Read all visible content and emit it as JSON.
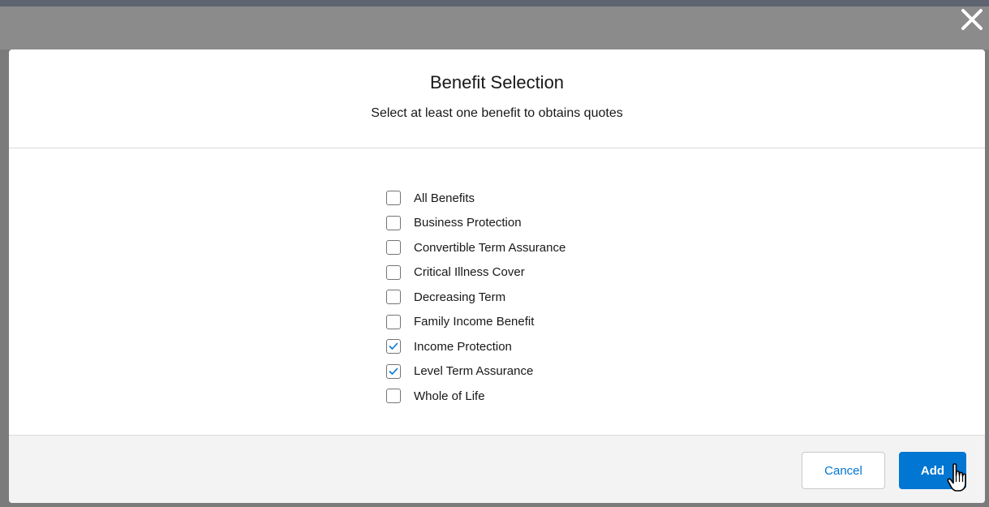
{
  "modal": {
    "title": "Benefit Selection",
    "subtitle": "Select at least one benefit to obtains quotes"
  },
  "benefits": [
    {
      "label": "All Benefits",
      "checked": false
    },
    {
      "label": "Business Protection",
      "checked": false
    },
    {
      "label": "Convertible Term Assurance",
      "checked": false
    },
    {
      "label": "Critical Illness Cover",
      "checked": false
    },
    {
      "label": "Decreasing Term",
      "checked": false
    },
    {
      "label": "Family Income Benefit",
      "checked": false
    },
    {
      "label": "Income Protection",
      "checked": true
    },
    {
      "label": "Level Term Assurance",
      "checked": true
    },
    {
      "label": "Whole of Life",
      "checked": false
    }
  ],
  "footer": {
    "cancel_label": "Cancel",
    "add_label": "Add"
  },
  "icons": {
    "close": "close-icon",
    "check": "checkmark-icon",
    "cursor": "hand-pointer-icon"
  },
  "colors": {
    "brand_blue": "#0176d3",
    "overlay": "#7b7b7b",
    "footer_bg": "#f3f3f3"
  }
}
